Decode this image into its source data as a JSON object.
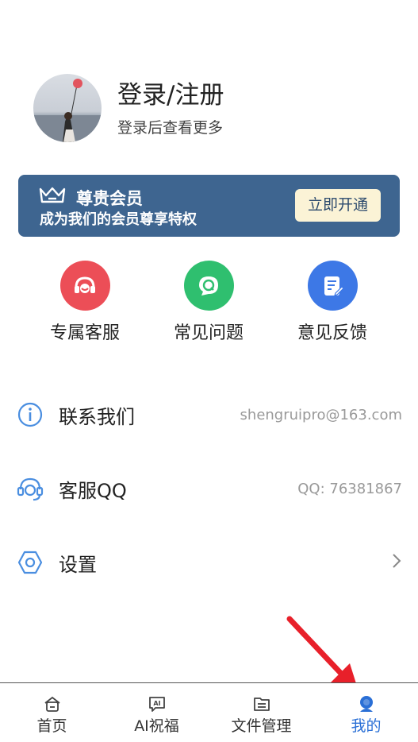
{
  "profile": {
    "title": "登录/注册",
    "subtitle": "登录后查看更多"
  },
  "vip": {
    "title": "尊贵会员",
    "subtitle": "成为我们的会员尊享特权",
    "button": "立即开通",
    "colors": {
      "banner": "#3e6590",
      "button_bg": "#fbf3d6"
    }
  },
  "shortcuts": [
    {
      "label": "专属客服",
      "icon": "headset-icon",
      "color": "#ec4e57"
    },
    {
      "label": "常见问题",
      "icon": "question-icon",
      "color": "#2fbf6f"
    },
    {
      "label": "意见反馈",
      "icon": "feedback-icon",
      "color": "#3d78e6"
    }
  ],
  "list": [
    {
      "label": "联系我们",
      "value": "shengruipro@163.com",
      "icon": "info-icon"
    },
    {
      "label": "客服QQ",
      "value": "QQ: 76381867",
      "icon": "headset-outline-icon"
    },
    {
      "label": "设置",
      "value": "",
      "icon": "hexagon-settings-icon"
    }
  ],
  "tabs": [
    {
      "label": "首页",
      "icon": "home-icon",
      "active": false
    },
    {
      "label": "AI祝福",
      "icon": "ai-chat-icon",
      "active": false
    },
    {
      "label": "文件管理",
      "icon": "folder-icon",
      "active": false
    },
    {
      "label": "我的",
      "icon": "profile-icon",
      "active": true
    }
  ],
  "accent_color": "#2a6fd6"
}
